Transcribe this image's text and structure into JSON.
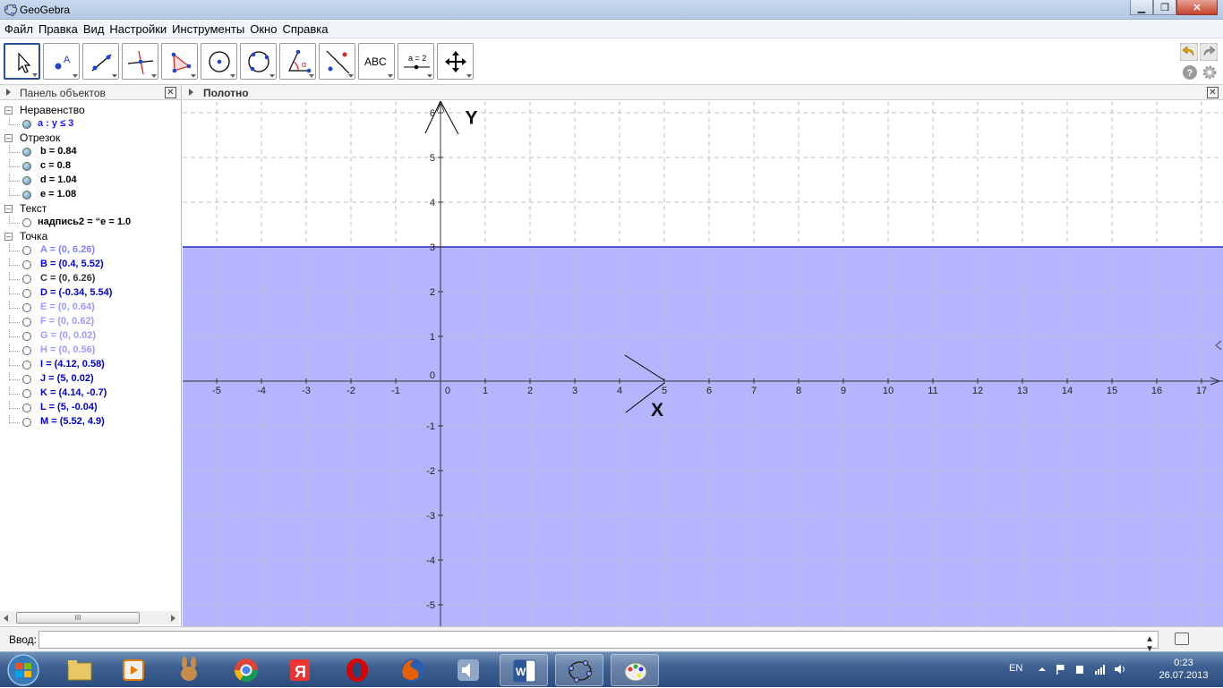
{
  "window": {
    "title": "GeoGebra"
  },
  "menu": [
    "Файл",
    "Правка",
    "Вид",
    "Настройки",
    "Инструменты",
    "Окно",
    "Справка"
  ],
  "toolbar": {
    "tools": [
      {
        "name": "move-tool-icon",
        "label": ""
      },
      {
        "name": "point-tool-icon",
        "label": "A"
      },
      {
        "name": "line-tool-icon",
        "label": ""
      },
      {
        "name": "perpendicular-tool-icon",
        "label": ""
      },
      {
        "name": "polygon-tool-icon",
        "label": ""
      },
      {
        "name": "circle-tool-icon",
        "label": ""
      },
      {
        "name": "circle-three-points-tool-icon",
        "label": ""
      },
      {
        "name": "angle-tool-icon",
        "label": "α"
      },
      {
        "name": "reflect-tool-icon",
        "label": ""
      },
      {
        "name": "text-tool-icon",
        "label": "ABC"
      },
      {
        "name": "slider-tool-icon",
        "label": "a = 2"
      },
      {
        "name": "move-view-tool-icon",
        "label": ""
      }
    ]
  },
  "algebra_panel": {
    "title": "Панель объектов",
    "categories": [
      {
        "label": "Неравенство",
        "items": [
          {
            "text": "a :  y  ≤  3",
            "color": "#1a1aff",
            "filled": true
          }
        ]
      },
      {
        "label": "Отрезок",
        "items": [
          {
            "text": "b = 0.84",
            "color": "#000000",
            "filled": true
          },
          {
            "text": "c = 0.8",
            "color": "#000000",
            "filled": true
          },
          {
            "text": "d = 1.04",
            "color": "#000000",
            "filled": true
          },
          {
            "text": "e = 1.08",
            "color": "#000000",
            "filled": true
          }
        ]
      },
      {
        "label": "Текст",
        "items": [
          {
            "text": "надпись2  =  “e    =   1.0",
            "color": "#000000",
            "filled": false
          }
        ]
      },
      {
        "label": "Точка",
        "items": [
          {
            "text": "A = (0, 6.26)",
            "color": "#7f7fff",
            "filled": false
          },
          {
            "text": "B = (0.4, 5.52)",
            "color": "#0000cc",
            "filled": false
          },
          {
            "text": "C = (0, 6.26)",
            "color": "#333333",
            "filled": false
          },
          {
            "text": "D = (-0.34, 5.54)",
            "color": "#0000cc",
            "filled": false
          },
          {
            "text": "E = (0, 0.64)",
            "color": "#9a9aff",
            "filled": false
          },
          {
            "text": "F = (0, 0.62)",
            "color": "#9a9aff",
            "filled": false
          },
          {
            "text": "G = (0, 0.02)",
            "color": "#9a9aff",
            "filled": false
          },
          {
            "text": "H = (0, 0.56)",
            "color": "#9a9aff",
            "filled": false
          },
          {
            "text": "I = (4.12, 0.58)",
            "color": "#0000cc",
            "filled": false
          },
          {
            "text": "J = (5, 0.02)",
            "color": "#0000cc",
            "filled": false
          },
          {
            "text": "K = (4.14, -0.7)",
            "color": "#0000cc",
            "filled": false
          },
          {
            "text": "L = (5, -0.04)",
            "color": "#0000cc",
            "filled": false
          },
          {
            "text": "M = (5.52, 4.9)",
            "color": "#0000cc",
            "filled": false
          }
        ]
      }
    ],
    "scroll_thumb": "III"
  },
  "graphics": {
    "title": "Полотно",
    "x_ticks": [
      "-5",
      "-4",
      "-3",
      "-2",
      "-1",
      "0",
      "1",
      "2",
      "3",
      "4",
      "5",
      "6",
      "7",
      "8",
      "9",
      "10",
      "11",
      "12",
      "13",
      "14",
      "15",
      "16",
      "17"
    ],
    "y_ticks": [
      "6",
      "5",
      "4",
      "3",
      "2",
      "1",
      "0",
      "-1",
      "-2",
      "-3",
      "-4",
      "-5"
    ],
    "x_range": [
      -5.75,
      17.25
    ],
    "y_range": [
      -5.5,
      6.3
    ],
    "inequality_bound": 3,
    "shade_color": "#b4b4ff",
    "axis_label_x": "X",
    "axis_label_y": "Y"
  },
  "input_bar": {
    "label": "Ввод:",
    "value": ""
  },
  "taskbar": {
    "apps": [
      "explorer",
      "media-player",
      "skype-rabbit",
      "chrome",
      "yandex",
      "opera",
      "firefox",
      "volume-app",
      "word",
      "geogebra",
      "paint"
    ],
    "lang": "EN",
    "time": "0:23",
    "date": "26.07.2013"
  }
}
